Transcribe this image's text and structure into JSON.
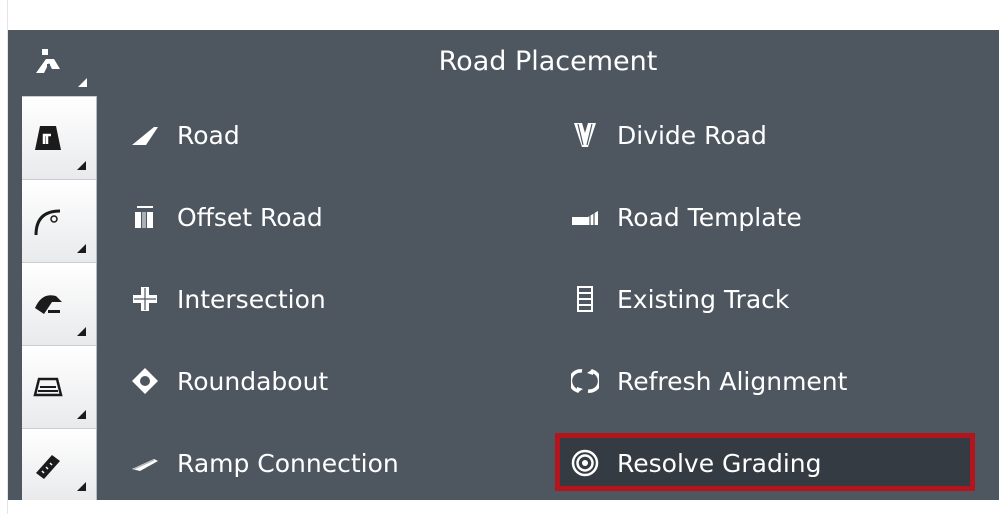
{
  "panel": {
    "title": "Road Placement"
  },
  "rail": [
    {
      "icon": "road-tools-icon",
      "active": true
    },
    {
      "icon": "road-sign-icon",
      "active": false
    },
    {
      "icon": "curve-icon",
      "active": false
    },
    {
      "icon": "terrain-icon",
      "active": false
    },
    {
      "icon": "surface-icon",
      "active": false
    },
    {
      "icon": "measure-icon",
      "active": false
    }
  ],
  "items": {
    "road": {
      "label": "Road",
      "icon": "road-icon"
    },
    "divide_road": {
      "label": "Divide Road",
      "icon": "divide-road-icon"
    },
    "offset_road": {
      "label": "Offset Road",
      "icon": "offset-road-icon"
    },
    "road_template": {
      "label": "Road Template",
      "icon": "road-template-icon"
    },
    "intersection": {
      "label": "Intersection",
      "icon": "intersection-icon"
    },
    "existing_track": {
      "label": "Existing Track",
      "icon": "existing-track-icon"
    },
    "roundabout": {
      "label": "Roundabout",
      "icon": "roundabout-icon"
    },
    "refresh_alignment": {
      "label": "Refresh Alignment",
      "icon": "refresh-icon"
    },
    "ramp_connection": {
      "label": "Ramp Connection",
      "icon": "ramp-icon"
    },
    "resolve_grading": {
      "label": "Resolve Grading",
      "icon": "target-icon",
      "highlighted": true
    }
  },
  "colors": {
    "panel_bg": "#4e5760",
    "highlight_border": "#b4141b",
    "text": "#ffffff"
  }
}
